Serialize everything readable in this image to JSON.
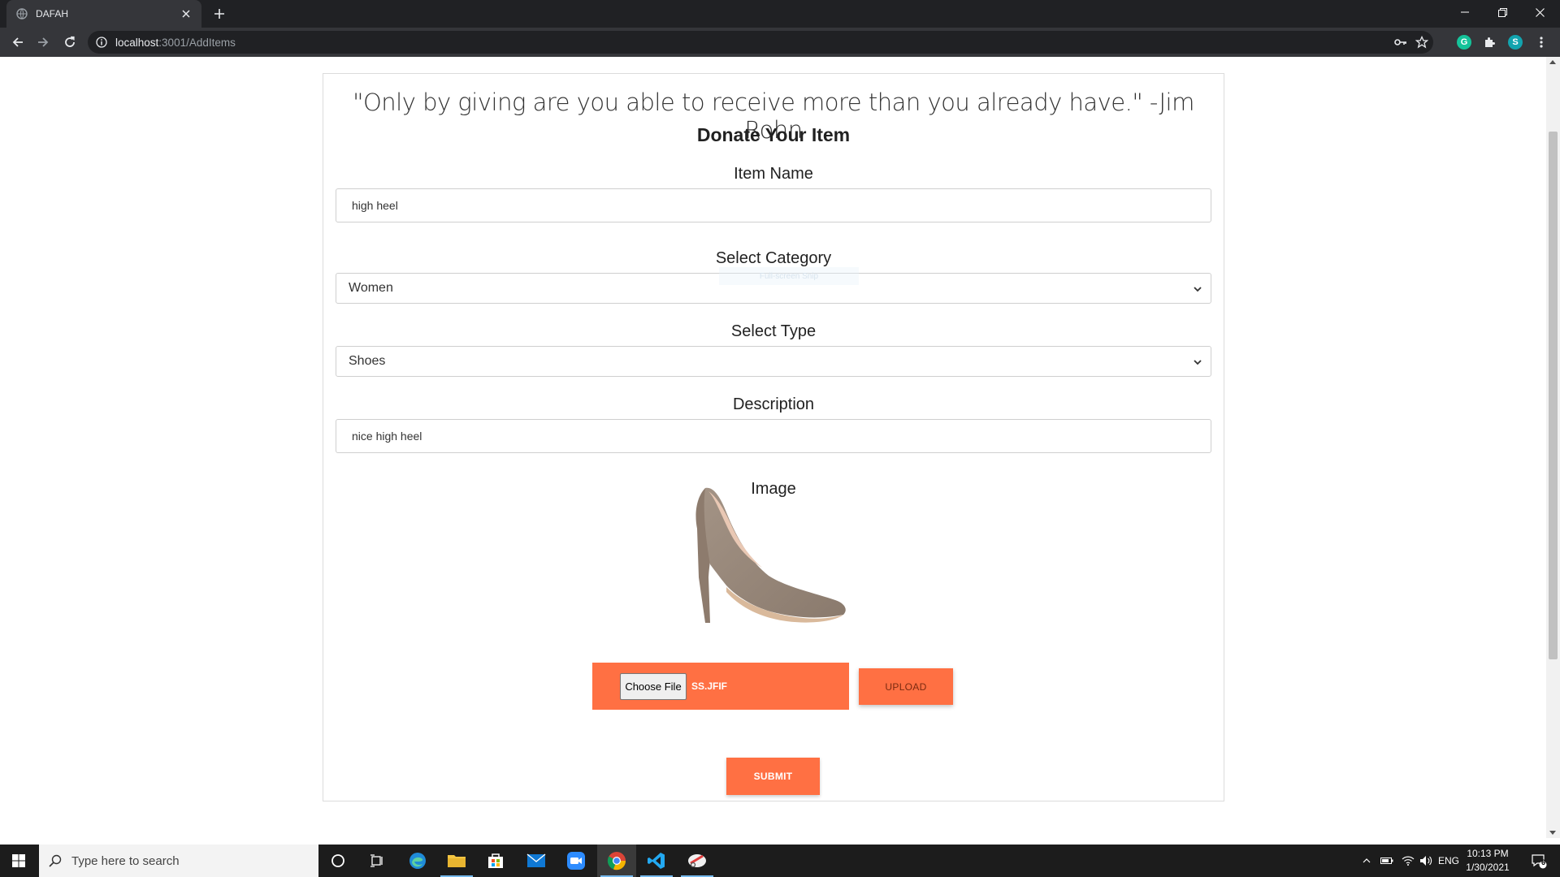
{
  "browser": {
    "tab_title": "DAFAH",
    "url_host": "localhost",
    "url_path": ":3001/AddItems",
    "profile_initial": "S",
    "grammarly_initial": "G"
  },
  "page": {
    "quote": "\"Only by giving are you able to receive more than you already have.\" -Jim Rohn",
    "heading": "Donate Your Item",
    "item_name": {
      "label": "Item Name",
      "value": "high heel"
    },
    "category": {
      "label": "Select Category",
      "selected": "Women"
    },
    "type": {
      "label": "Select Type",
      "selected": "Shoes"
    },
    "description": {
      "label": "Description",
      "value": "nice high heel"
    },
    "image": {
      "label": "Image"
    },
    "file": {
      "choose_label": "Choose File",
      "file_name": "SS.JFIF"
    },
    "upload_label": "UPLOAD",
    "submit_label": "SUBMIT",
    "snip_overlay": "Full-screen Snip"
  },
  "taskbar": {
    "search_placeholder": "Type here to search",
    "language": "ENG",
    "time": "10:13 PM",
    "date": "1/30/2021",
    "notification_count": "6"
  },
  "colors": {
    "accent": "#ff7043",
    "chrome_dark": "#202124",
    "chrome_toolbar": "#35363a",
    "taskbar": "#1c1c1c"
  }
}
